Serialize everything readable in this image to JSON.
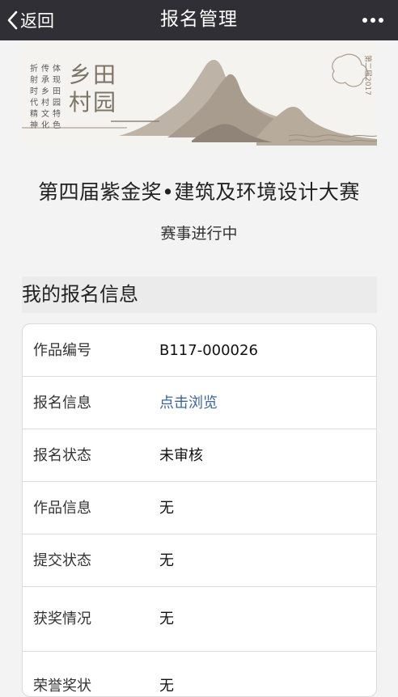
{
  "navbar": {
    "back_label": "返回",
    "title": "报名管理"
  },
  "banner": {
    "logo_text": "乡田村园",
    "slogan_columns": [
      "体现田园特色",
      "传承乡村文化",
      "折射时代精神"
    ],
    "year_text": "第二届2017"
  },
  "competition": {
    "title": "第四届紫金奖•建筑及环境设计大赛",
    "status": "赛事进行中"
  },
  "section": {
    "title": "我的报名信息"
  },
  "info_rows": [
    {
      "label": "作品编号",
      "value": "B117-000026"
    },
    {
      "label": "报名信息",
      "value": "点击浏览"
    },
    {
      "label": "报名状态",
      "value": "未审核"
    },
    {
      "label": "作品信息",
      "value": "无"
    },
    {
      "label": "提交状态",
      "value": "无"
    },
    {
      "label": "获奖情况",
      "value": "无"
    },
    {
      "label": "荣誉奖状",
      "value": "无"
    }
  ],
  "colors": {
    "navbar_bg": "#2f2f35",
    "link": "#3c64a8",
    "page_bg": "#f3f3f3"
  }
}
